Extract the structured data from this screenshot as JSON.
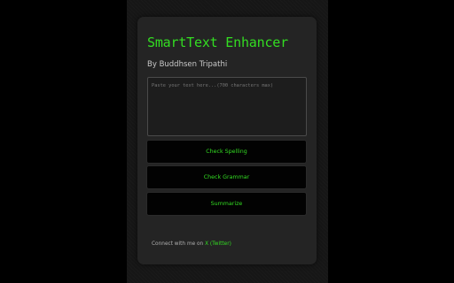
{
  "app": {
    "title": "SmartText Enhancer",
    "author": "By Buddhsen Tripathi"
  },
  "input": {
    "placeholder": "Paste your text here...(700 characters max)",
    "value": ""
  },
  "buttons": {
    "check_spelling": "Check Spelling",
    "check_grammar": "Check Grammar",
    "summarize": "Summarize"
  },
  "footer": {
    "text": "Connect with me on ",
    "link_label": "X (Twitter)"
  },
  "colors": {
    "accent": "#33dd22",
    "card_bg": "#242424",
    "page_bg": "#000000"
  }
}
